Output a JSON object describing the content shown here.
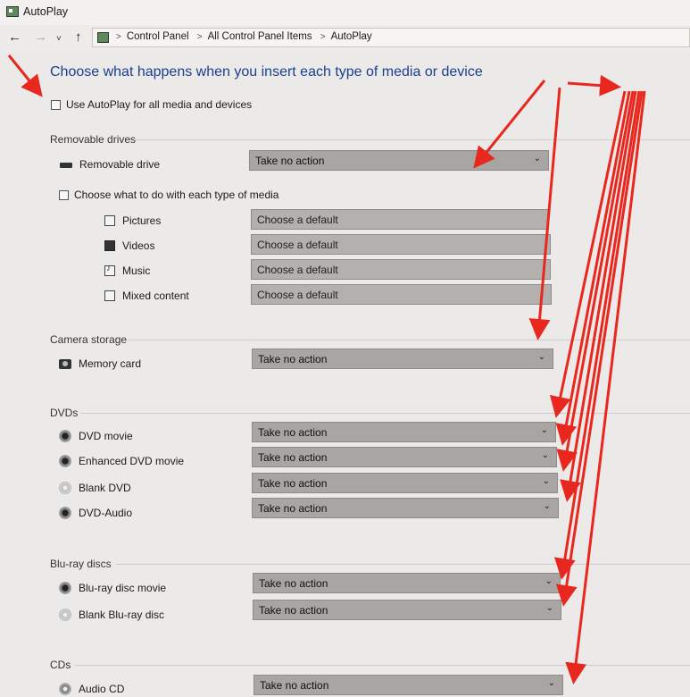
{
  "window": {
    "title": "AutoPlay"
  },
  "nav": {
    "back_icon": "←",
    "forward_icon": "→",
    "recent_icon": "˅",
    "up_icon": "↑",
    "breadcrumbs": [
      "Control Panel",
      "All Control Panel Items",
      "AutoPlay"
    ],
    "separator": ">"
  },
  "page": {
    "heading": "Choose what happens when you insert each type of media or device",
    "use_autoplay_label": "Use AutoPlay for all media and devices"
  },
  "removable": {
    "section": "Removable drives",
    "drive_label": "Removable drive",
    "drive_value": "Take no action",
    "choose_label": "Choose what to do with each type of media",
    "media": [
      {
        "label": "Pictures",
        "value": "Choose a default"
      },
      {
        "label": "Videos",
        "value": "Choose a default"
      },
      {
        "label": "Music",
        "value": "Choose a default"
      },
      {
        "label": "Mixed content",
        "value": "Choose a default"
      }
    ]
  },
  "camera": {
    "section": "Camera storage",
    "label": "Memory card",
    "value": "Take no action"
  },
  "dvds": {
    "section": "DVDs",
    "items": [
      {
        "label": "DVD movie",
        "value": "Take no action"
      },
      {
        "label": "Enhanced DVD movie",
        "value": "Take no action"
      },
      {
        "label": "Blank DVD",
        "value": "Take no action"
      },
      {
        "label": "DVD-Audio",
        "value": "Take no action"
      }
    ]
  },
  "bluray": {
    "section": "Blu-ray discs",
    "items": [
      {
        "label": "Blu-ray disc movie",
        "value": "Take no action"
      },
      {
        "label": "Blank Blu-ray disc",
        "value": "Take no action"
      }
    ]
  },
  "cds": {
    "section": "CDs",
    "items": [
      {
        "label": "Audio CD",
        "value": "Take no action"
      }
    ]
  },
  "chevron_icon": "⌄",
  "annotation_color": "#e8281e"
}
